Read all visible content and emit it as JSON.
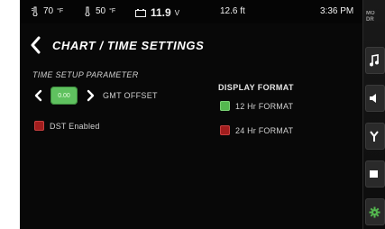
{
  "status_bar": {
    "temp_left": "70",
    "temp_left_unit": "°F",
    "temp_right": "50",
    "temp_right_unit": "°F",
    "battery_value": "11.9",
    "battery_unit": "V",
    "depth": "12.6 ft",
    "time": "3:36 PM"
  },
  "page": {
    "title": "CHART / TIME SETTINGS"
  },
  "time_setup": {
    "section_label": "TIME SETUP PARAMETER",
    "gmt_offset_value": "0.00",
    "gmt_offset_label": "GMT OFFSET",
    "dst_label": "DST Enabled",
    "dst_enabled": false
  },
  "display_format": {
    "title": "DISPLAY FORMAT",
    "options": [
      {
        "label": "12 Hr FORMAT",
        "selected": true
      },
      {
        "label": "24 Hr FORMAT",
        "selected": false
      }
    ]
  },
  "sidebar": {
    "top_label_line1": "MO",
    "top_label_line2": "DR",
    "icons": [
      "music-icon",
      "speaker-icon",
      "tools-icon",
      "screen-icon",
      "gear-icon"
    ]
  },
  "colors": {
    "selected": "#54b84f",
    "unselected": "#a11d1d",
    "value_box": "#5fc15f"
  }
}
